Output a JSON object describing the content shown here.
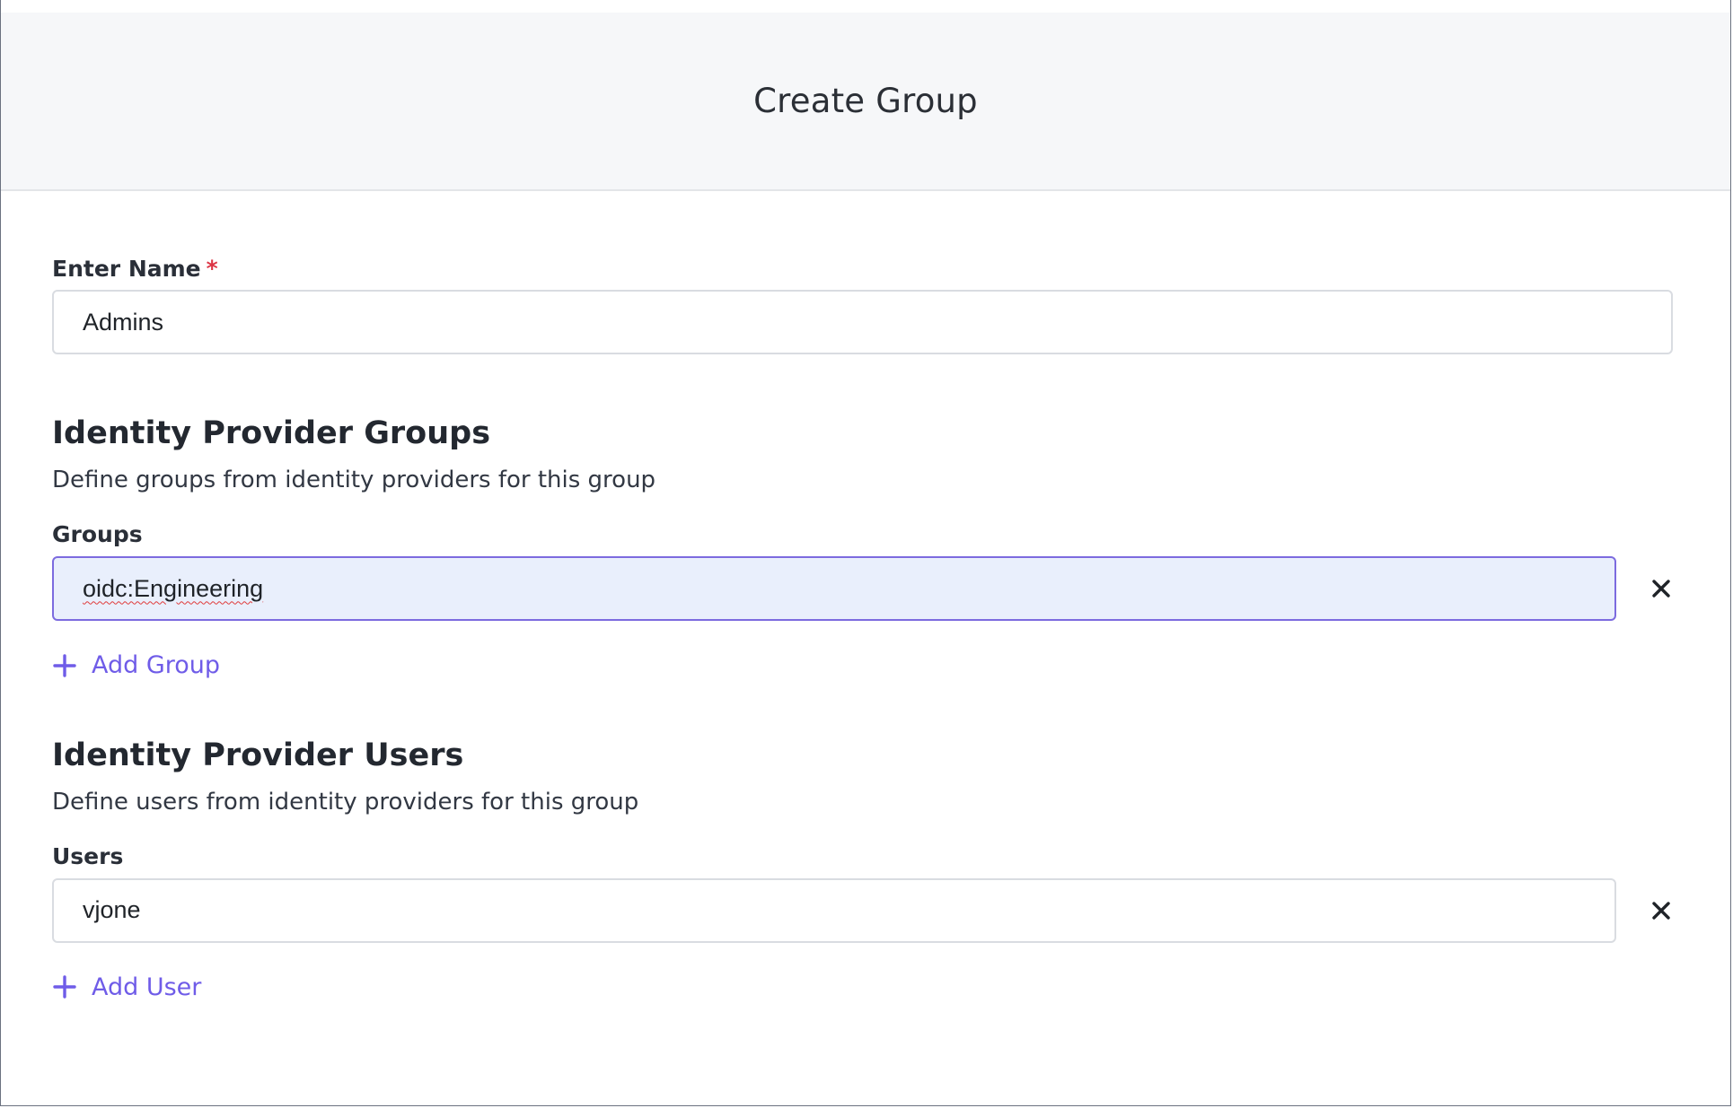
{
  "header": {
    "title": "Create Group"
  },
  "name_field": {
    "label": "Enter Name",
    "required_marker": "*",
    "value": "Admins"
  },
  "groups_section": {
    "title": "Identity Provider Groups",
    "description": "Define groups from identity providers for this group",
    "field_label": "Groups",
    "items": [
      {
        "value": "oidc:Engineering"
      }
    ],
    "add_label": "Add Group"
  },
  "users_section": {
    "title": "Identity Provider Users",
    "description": "Define users from identity providers for this group",
    "field_label": "Users",
    "items": [
      {
        "value": "vjone"
      }
    ],
    "add_label": "Add User"
  },
  "icons": {
    "remove": "close-icon",
    "add": "plus-icon"
  },
  "colors": {
    "accent": "#6f5ce8",
    "focus_border": "#7c6bdf",
    "focus_background": "#e9effc",
    "required": "#dc3545",
    "header_background": "#f6f7f9"
  }
}
